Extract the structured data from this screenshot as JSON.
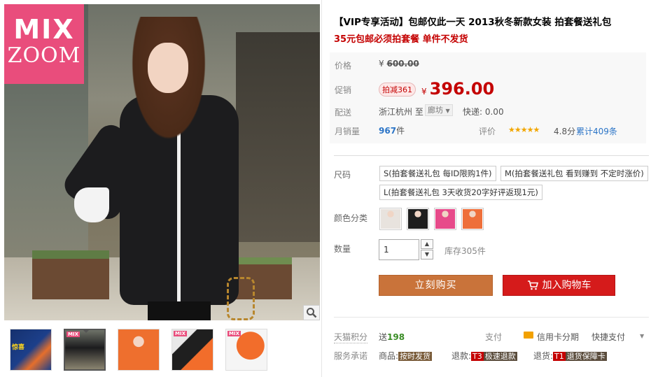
{
  "brand": {
    "logo_line1": "MIX",
    "logo_line2": "ZOOM"
  },
  "thumbnails": [
    {
      "badge": "",
      "overlay": "惊喜"
    },
    {
      "badge": "MIX",
      "overlay": ""
    },
    {
      "badge": "",
      "overlay": ""
    },
    {
      "badge": "MIX",
      "overlay": ""
    },
    {
      "badge": "MIX",
      "overlay": ""
    }
  ],
  "product": {
    "title": "【VIP专享活动】包邮仅此一天 2013秋冬新款女装 拍套餐送礼包",
    "subtitle": "35元包邮必须拍套餐 单件不发货"
  },
  "pricing": {
    "price_label": "价格",
    "currency": "¥",
    "original_price": "600.00",
    "promo_label": "促销",
    "promo_tag": "拍减361",
    "promo_price": "396.00"
  },
  "shipping": {
    "label": "配送",
    "from": "浙江杭州",
    "to_word": "至",
    "destination": "廊坊",
    "fee": "快递: 0.00"
  },
  "sales": {
    "label": "月销量",
    "count": "967",
    "unit": "件",
    "review_label": "评价",
    "stars": "★★★★★",
    "score": "4.8分",
    "reviews": "累计409条"
  },
  "options": {
    "size_label": "尺码",
    "sizes": [
      "S(拍套餐送礼包 每ID限购1件)",
      "M(拍套餐送礼包 看到赚到 不定时涨价)",
      "L(拍套餐送礼包 3天收货20字好评返现1元)"
    ],
    "color_label": "颜色分类",
    "colors": [
      "white",
      "black",
      "pink",
      "orange"
    ]
  },
  "quantity": {
    "label": "数量",
    "value": "1",
    "stock": "库存305件"
  },
  "buttons": {
    "buy_now": "立刻购买",
    "add_cart": "加入购物车"
  },
  "footer": {
    "points_label": "天猫积分",
    "points_prefix": "送",
    "points": "198",
    "pay_label": "支付",
    "credit_card": "信用卡分期",
    "quick_pay": "快捷支付",
    "service_label": "服务承诺",
    "goods_label": "商品:",
    "goods_tag": "按时发货",
    "refund_label": "退款:",
    "refund_badge": "T3",
    "refund_tag": "极速退款",
    "return_label": "退货:",
    "return_badge": "T1",
    "return_tag": "退货保障卡"
  },
  "colors": {
    "accent_red": "#c40000",
    "buy_orange": "#c9733a",
    "cart_red": "#d51b1b",
    "logo_pink": "#e94d7c"
  }
}
